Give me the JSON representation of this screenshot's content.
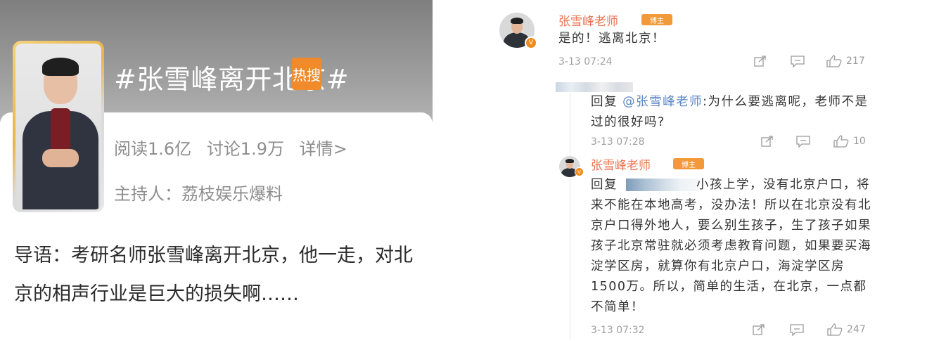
{
  "topic": {
    "title": "#张雪峰离开北京#",
    "hot_badge": "热搜",
    "reads": "阅读1.6亿",
    "discussions": "讨论1.9万",
    "details": "详情>",
    "host": "主持人：荔枝娱乐爆料",
    "intro": "导语：考研名师张雪峰离开北京，他一走，对北京的相声行业是巨大的损失啊……"
  },
  "comments": {
    "main": {
      "username": "张雪峰老师",
      "badge": "博主",
      "text": "是的！逃离北京！",
      "time": "3-13 07:24",
      "likes": "217"
    },
    "reply1": {
      "prefix": "回复 ",
      "mention": "@张雪峰老师",
      "text": ":为什么要逃离呢，老师不是过的很好吗?",
      "time": "3-13 07:28",
      "likes": "10"
    },
    "reply2": {
      "username": "张雪峰老师",
      "badge": "博主",
      "prefix": "回复",
      "text": "小孩上学，没有北京户口，将来不能在本地高考，没办法！所以在北京没有北京户口得外地人，要么别生孩子，生了孩子如果孩子北京常驻就必须考虑教育问题，如果要买海淀学区房，就算你有北京户口，海淀学区房1500万。所以，简单的生活，在北京，一点都不简单！",
      "time": "3-13 07:32",
      "likes": "247"
    }
  },
  "icons": {
    "share": "share-icon",
    "comment": "comment-icon",
    "like": "thumbs-up-icon",
    "verified": "verified-badge-icon"
  },
  "colors": {
    "username": "#eb7350",
    "mention": "#5b87c6",
    "hot_badge": "#f08a2a",
    "meta_text": "#a0a0a0"
  }
}
